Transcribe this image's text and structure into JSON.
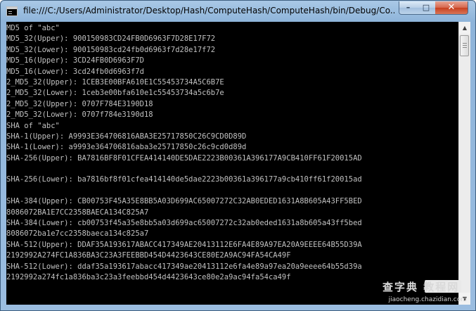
{
  "window": {
    "title": "file:///C:/Users/Administrator/Desktop/Hash/ComputeHash/ComputeHash/bin/Debug/Co...",
    "minimize_glyph": "–",
    "maximize_glyph": "□",
    "close_glyph": "✕"
  },
  "console": {
    "lines": [
      "MD5 of \"abc\"",
      "MD5_32(Upper): 900150983CD24FB0D6963F7D28E17F72",
      "MD5_32(Lower): 900150983cd24fb0d6963f7d28e17f72",
      "MD5_16(Upper): 3CD24FB0D6963F7D",
      "MD5_16(Lower): 3cd24fb0d6963f7d",
      "2_MD5_32(Upper): 1CEB3E00BFA610E1C55453734A5C6B7E",
      "2_MD5_32(Lower): 1ceb3e00bfa610e1c55453734a5c6b7e",
      "2_MD5_32(Upper): 0707F784E3190D18",
      "2_MD5_32(Lower): 0707f784e3190d18",
      "SHA of \"abc\"",
      "SHA-1(Upper): A9993E364706816ABA3E25717850C26C9CD0D89D",
      "SHA-1(Lower): a9993e364706816aba3e25717850c26c9cd0d89d",
      "SHA-256(Upper): BA7816BF8F01CFEA414140DE5DAE2223B00361A396177A9CB410FF61F20015AD",
      "",
      "SHA-256(Lower): ba7816bf8f01cfea414140de5dae2223b00361a396177a9cb410ff61f20015ad",
      "",
      "SHA-384(Upper): CB00753F45A35E8BB5A03D699AC65007272C32AB0EDED1631A8B605A43FF5BED",
      "8086072BA1E7CC2358BAECA134C825A7",
      "SHA-384(Lower): cb00753f45a35e8bb5a03d699ac65007272c32ab0eded1631a8b605a43ff5bed",
      "8086072ba1e7cc2358baeca134c825a7",
      "SHA-512(Upper): DDAF35A193617ABACC417349AE20413112E6FA4E89A97EA20A9EEEE64B55D39A",
      "2192992A274FC1A836BA3C23A3FEEBBD454D4423643CE80E2A9AC94FA54CA49F",
      "SHA-512(Lower): ddaf35a193617abacc417349ae20413112e6fa4e89a97ea20a9eeee64b55d39a",
      "2192992a274fc1a836ba3c23a3feebbd454d4423643ce80e2a9ac94fa54ca49f"
    ]
  },
  "scrollbar": {
    "up_glyph": "▲",
    "down_glyph": "▼"
  },
  "watermark": {
    "main": "查字典 教程网",
    "sub": "jiaocheng.chazidian.com"
  },
  "colors": {
    "console_bg": "#000000",
    "console_text": "#c0c0c0",
    "title_bar": "#9bbde0",
    "close_button": "#c7401f"
  }
}
